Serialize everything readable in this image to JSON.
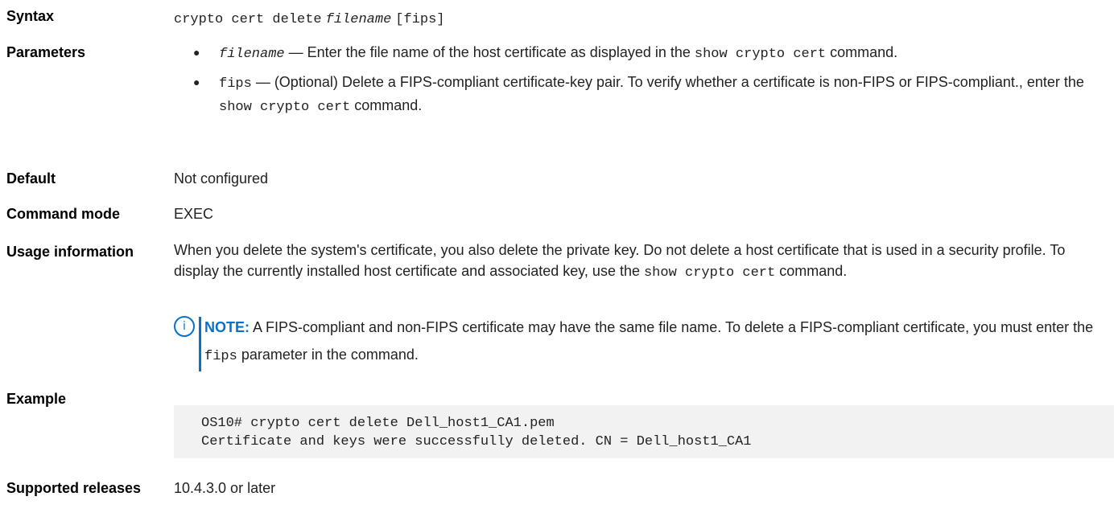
{
  "syntax": {
    "label": "Syntax",
    "command": "crypto cert delete",
    "arg": "filename",
    "option": "[fips]"
  },
  "parameters": {
    "label": "Parameters",
    "items": [
      {
        "name": "filename",
        "text_before": " — Enter the file name of the host certificate as displayed in the ",
        "code": "show crypto cert",
        "text_after": " command."
      },
      {
        "name": "fips",
        "text_before": " — (Optional) Delete a FIPS-compliant certificate-key pair. To verify whether a certificate is non-FIPS or FIPS-compliant., enter the ",
        "code": "show crypto cert",
        "text_after": " command."
      }
    ]
  },
  "default": {
    "label": "Default",
    "value": "Not configured"
  },
  "command_mode": {
    "label": "Command mode",
    "value": "EXEC"
  },
  "usage": {
    "label": "Usage information",
    "text_before": "When you delete the system's certificate, you also delete the private key. Do not delete a host certificate that is used in a security profile. To display the currently installed host certificate and associated key, use the ",
    "code": "show crypto cert",
    "text_after": " command.",
    "note": {
      "title": "NOTE:",
      "text_before": " A FIPS-compliant and non-FIPS certificate may have the same file name. To delete a FIPS-compliant certificate, you must enter the ",
      "code": "fips",
      "text_after": " parameter in the command."
    }
  },
  "example": {
    "label": "Example",
    "code": "OS10# crypto cert delete Dell_host1_CA1.pem\nCertificate and keys were successfully deleted. CN = Dell_host1_CA1"
  },
  "supported_releases": {
    "label": "Supported releases",
    "value": "10.4.3.0 or later"
  },
  "colors": {
    "accent": "#0672cb",
    "code_bg": "#f2f2f2",
    "text": "#222222"
  },
  "icons": {
    "note": "info-icon",
    "bullet": "bullet-icon"
  }
}
